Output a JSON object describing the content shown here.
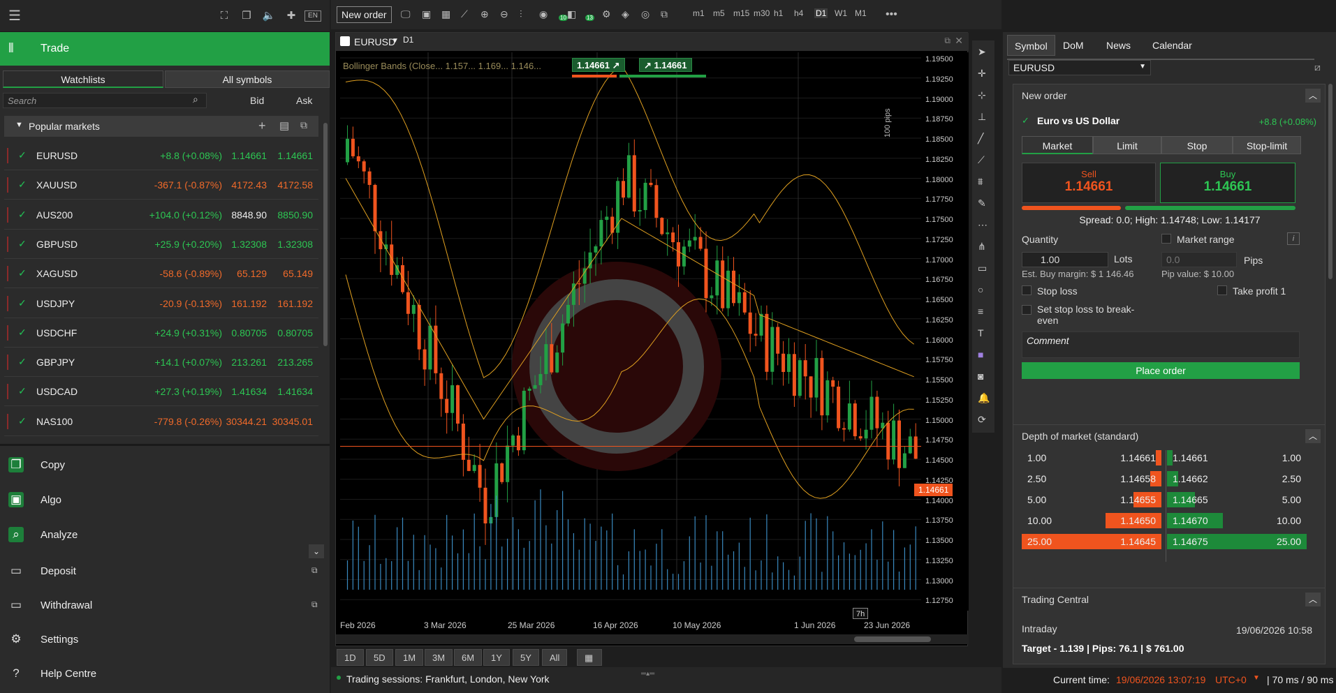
{
  "left": {
    "topbar_badge": "EN",
    "trade_label": "Trade",
    "tabs": [
      "Watchlists",
      "All symbols"
    ],
    "search_placeholder": "Search",
    "col_bid": "Bid",
    "col_ask": "Ask",
    "group_label": "Popular markets",
    "rows": [
      {
        "symbol": "EURUSD",
        "change": "+8.8 (+0.08%)",
        "bid": "1.14661",
        "ask": "1.14661",
        "dir": "pos"
      },
      {
        "symbol": "XAUUSD",
        "change": "-367.1 (-0.87%)",
        "bid": "4172.43",
        "ask": "4172.58",
        "dir": "neg"
      },
      {
        "symbol": "AUS200",
        "change": "+104.0 (+0.12%)",
        "bid": "8848.90",
        "ask": "8850.90",
        "dir": "pos"
      },
      {
        "symbol": "GBPUSD",
        "change": "+25.9 (+0.20%)",
        "bid": "1.32308",
        "ask": "1.32308",
        "dir": "pos"
      },
      {
        "symbol": "XAGUSD",
        "change": "-58.6 (-0.89%)",
        "bid": "65.129",
        "ask": "65.149",
        "dir": "neg"
      },
      {
        "symbol": "USDJPY",
        "change": "-20.9 (-0.13%)",
        "bid": "161.192",
        "ask": "161.192",
        "dir": "neg"
      },
      {
        "symbol": "USDCHF",
        "change": "+24.9 (+0.31%)",
        "bid": "0.80705",
        "ask": "0.80705",
        "dir": "pos"
      },
      {
        "symbol": "GBPJPY",
        "change": "+14.1 (+0.07%)",
        "bid": "213.261",
        "ask": "213.265",
        "dir": "pos"
      },
      {
        "symbol": "USDCAD",
        "change": "+27.3 (+0.19%)",
        "bid": "1.41634",
        "ask": "1.41634",
        "dir": "pos"
      },
      {
        "symbol": "NAS100",
        "change": "-779.8 (-0.26%)",
        "bid": "30344.21",
        "ask": "30345.01",
        "dir": "neg"
      }
    ],
    "menu": [
      {
        "label": "Copy",
        "icon": "copy-icon"
      },
      {
        "label": "Algo",
        "icon": "robot-icon"
      },
      {
        "label": "Analyze",
        "icon": "analyze-icon"
      },
      {
        "label": "Deposit",
        "icon": "deposit-icon"
      },
      {
        "label": "Withdrawal",
        "icon": "withdrawal-icon"
      },
      {
        "label": "Settings",
        "icon": "gear-icon"
      },
      {
        "label": "Help Centre",
        "icon": "help-icon"
      }
    ]
  },
  "toolbar": {
    "new_order": "New order",
    "timeframes": [
      "m1",
      "m5",
      "m15",
      "m30",
      "h1",
      "h4",
      "D1",
      "W1",
      "M1"
    ],
    "badge1": "10",
    "badge2": "13"
  },
  "chart": {
    "symbol": "EURUSD",
    "period": "D1",
    "indicator": "Bollinger Bands (Close... 1.157... 1.169... 1.146...",
    "sell_quick": "1.14661",
    "buy_quick": "1.14661",
    "pips_label": "100 pips",
    "price_tag": "1.14661",
    "time_tag": "7h",
    "x_labels": [
      "Feb 2026",
      "3 Mar 2026",
      "25 Mar 2026",
      "16 Apr 2026",
      "10 May 2026",
      "1 Jun 2026",
      "23 Jun 2026"
    ],
    "y_labels": [
      "1.19500",
      "1.19250",
      "1.19000",
      "1.18750",
      "1.18500",
      "1.18250",
      "1.18000",
      "1.17750",
      "1.17500",
      "1.17250",
      "1.17000",
      "1.16750",
      "1.16500",
      "1.16250",
      "1.16000",
      "1.15750",
      "1.15500",
      "1.15250",
      "1.15000",
      "1.14750",
      "1.14500",
      "1.14250",
      "1.14000",
      "1.13750",
      "1.13500",
      "1.13250",
      "1.13000",
      "1.12750"
    ],
    "ranges": [
      "1D",
      "5D",
      "1M",
      "3M",
      "6M",
      "1Y",
      "5Y",
      "All"
    ]
  },
  "status": {
    "sessions": "Trading sessions: Frankfurt, London, New York",
    "current_time_label": "Current time:",
    "current_time": "19/06/2026 13:07:19",
    "tz": "UTC+0",
    "latency": "70 ms / 90 ms"
  },
  "right": {
    "tabs": [
      "Symbol",
      "DoM",
      "News",
      "Calendar"
    ],
    "symbol_select": "EURUSD",
    "new_order_title": "New order",
    "instrument": "Euro vs US Dollar",
    "instrument_change": "+8.8 (+0.08%)",
    "order_types": [
      "Market",
      "Limit",
      "Stop",
      "Stop-limit"
    ],
    "sell_label": "Sell",
    "sell_price": "1.14661",
    "buy_label": "Buy",
    "buy_price": "1.14661",
    "spread_line": "Spread: 0.0; High: 1.14748; Low: 1.14177",
    "quantity_label": "Quantity",
    "market_range": "Market range",
    "qty_value": "1.00",
    "lots": "Lots",
    "pips_value": "0.0",
    "pips": "Pips",
    "est_margin": "Est. Buy margin: $ 1 146.46",
    "pip_value": "Pip value: $ 10.00",
    "stop_loss": "Stop loss",
    "take_profit": "Take profit 1",
    "break_even": "Set stop loss to break-even",
    "comment": "Comment",
    "place_order": "Place order",
    "dom_title": "Depth of market (standard)",
    "dom_sell": [
      {
        "vol": "1.00",
        "price": "1.14661",
        "fill": 0.02
      },
      {
        "vol": "2.50",
        "price": "1.14658",
        "fill": 0.08
      },
      {
        "vol": "5.00",
        "price": "1.14655",
        "fill": 0.2
      },
      {
        "vol": "10.00",
        "price": "1.14650",
        "fill": 0.4
      },
      {
        "vol": "25.00",
        "price": "1.14645",
        "fill": 1.0
      }
    ],
    "dom_buy": [
      {
        "vol": "1.00",
        "price": "1.14661",
        "fill": 0.02
      },
      {
        "vol": "2.50",
        "price": "1.14662",
        "fill": 0.08
      },
      {
        "vol": "5.00",
        "price": "1.14665",
        "fill": 0.2
      },
      {
        "vol": "10.00",
        "price": "1.14670",
        "fill": 0.4
      },
      {
        "vol": "25.00",
        "price": "1.14675",
        "fill": 1.0
      }
    ],
    "tc_title": "Trading Central",
    "tc_period": "Intraday",
    "tc_date": "19/06/2026 10:58",
    "tc_target": "Target - 1.139 | Pips: 76.1 | $ 761.00"
  },
  "colors": {
    "green": "#22a045",
    "orange": "#f0541e",
    "accent_pos": "#2dc653",
    "accent_neg": "#f06a2a"
  }
}
